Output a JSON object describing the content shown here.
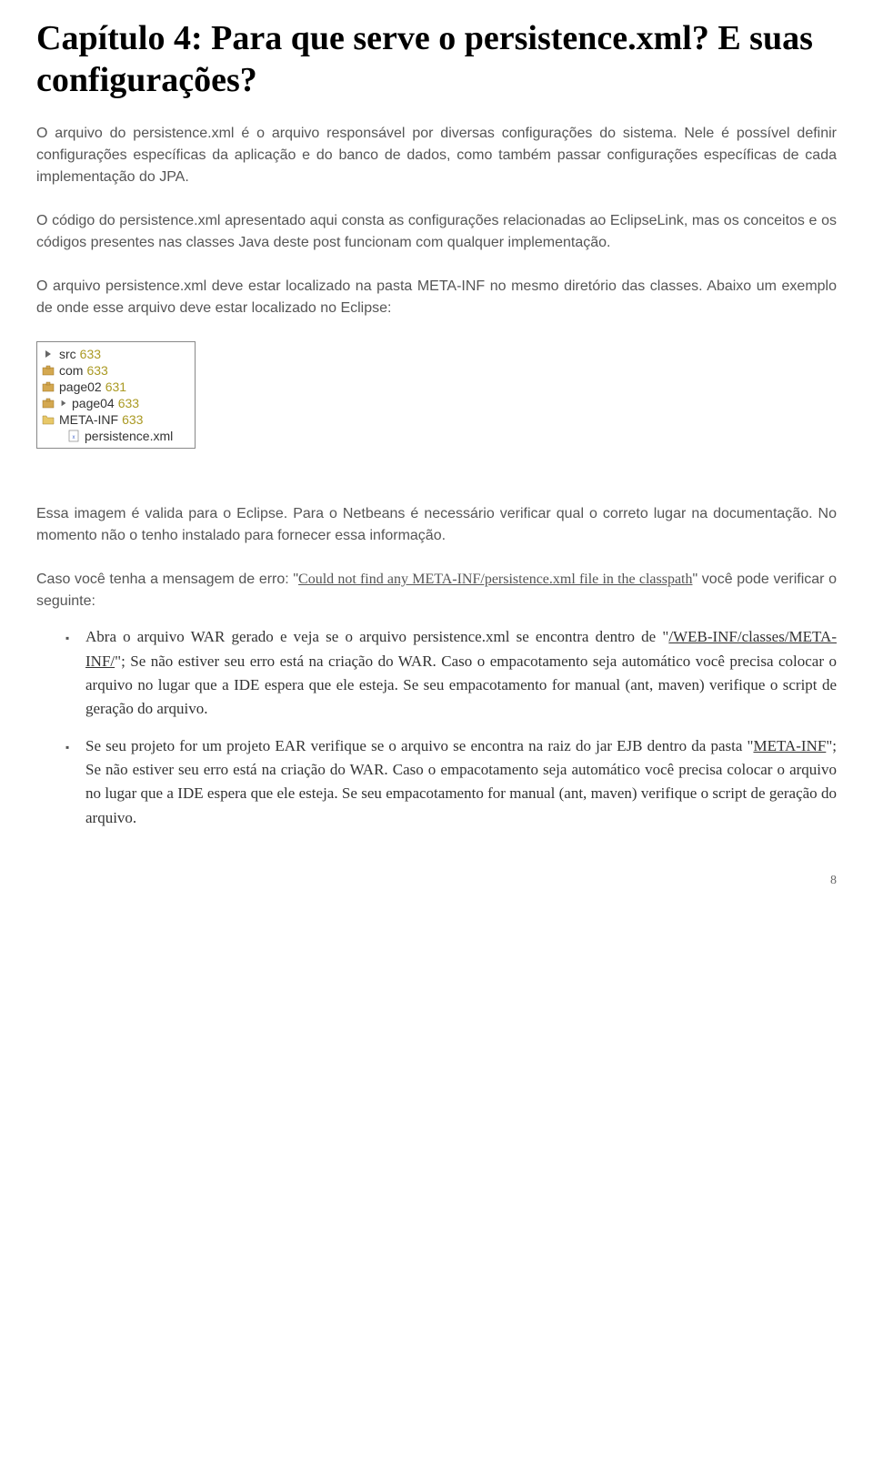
{
  "title": "Capítulo 4: Para que serve o persistence.xml? E suas configurações?",
  "para1": "O arquivo do persistence.xml é o arquivo responsável por diversas configurações do sistema. Nele é possível definir configurações específicas da aplicação e do banco de dados, como também passar configurações específicas de cada implementação do JPA.",
  "para2": "O código do persistence.xml apresentado aqui consta as configurações relacionadas ao EclipseLink, mas os conceitos e os códigos presentes nas classes Java deste post funcionam com qualquer implementação.",
  "para3": "O arquivo persistence.xml deve estar localizado na pasta META-INF no mesmo diretório das classes. Abaixo um exemplo de onde esse arquivo deve estar localizado no Eclipse:",
  "tree": {
    "rows": [
      {
        "indent": 0,
        "icon": "expand-arrow",
        "label": "src",
        "rev": "633"
      },
      {
        "indent": 0,
        "icon": "package",
        "label": "com",
        "rev": "633"
      },
      {
        "indent": 0,
        "icon": "package",
        "label": "page02",
        "rev": "631"
      },
      {
        "indent": 0,
        "icon": "package-expand",
        "label": "page04",
        "rev": "633"
      },
      {
        "indent": 0,
        "icon": "folder",
        "label": "META-INF",
        "rev": "633"
      },
      {
        "indent": 1,
        "icon": "xml-file",
        "label": "persistence.xml",
        "rev": ""
      }
    ]
  },
  "para4": "Essa imagem é valida para o Eclipse. Para o Netbeans é necessário verificar qual o correto lugar na documentação. No momento não o tenho instalado para fornecer essa informação.",
  "para5a": "Caso você tenha a mensagem de erro: \"",
  "para5b": "Could not find any META-INF/persistence.xml file in the classpath",
  "para5c": "\" você pode verificar o seguinte:",
  "bullet1a": "Abra o arquivo WAR gerado e veja se o arquivo persistence.xml se encontra dentro de \"",
  "bullet1b": "/WEB-INF/classes/META-INF/",
  "bullet1c": "\"; Se não estiver seu erro está na criação do WAR. Caso o empacotamento seja automático você precisa colocar o arquivo no lugar que a IDE espera que ele esteja. Se seu empacotamento for manual (ant, maven) verifique o script de geração do arquivo.",
  "bullet2a": "Se seu projeto for um projeto EAR verifique se o arquivo se encontra na raiz do jar EJB dentro da pasta \"",
  "bullet2b": "META-INF",
  "bullet2c": "\"; Se não estiver seu erro está na criação do WAR. Caso o empacotamento seja automático você precisa colocar o arquivo no lugar que a IDE espera que ele esteja. Se seu empacotamento for manual (ant, maven) verifique o script de geração do arquivo.",
  "pageNumber": "8"
}
